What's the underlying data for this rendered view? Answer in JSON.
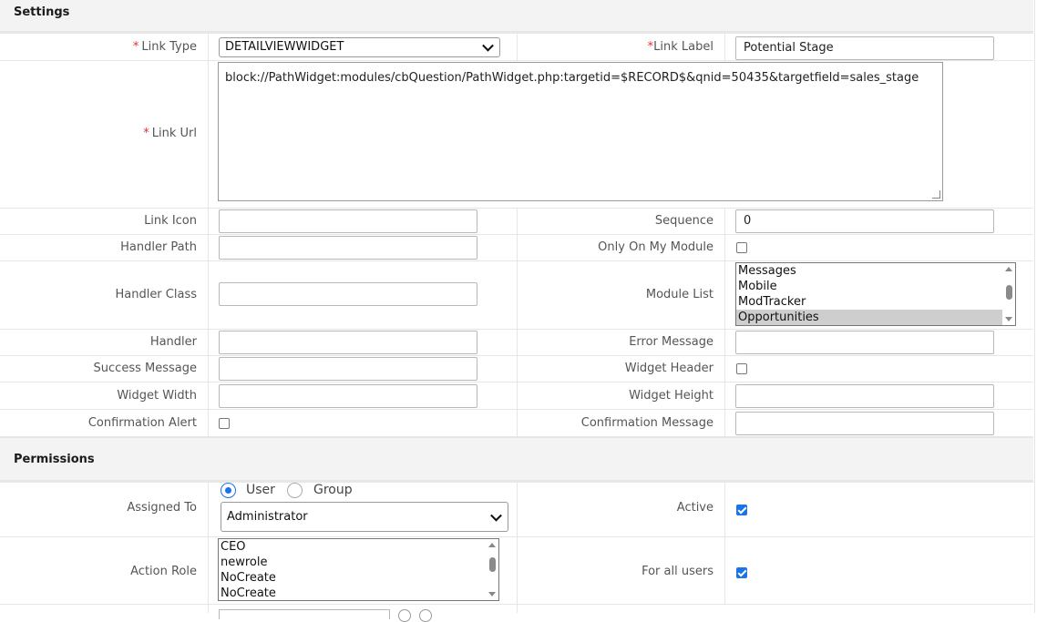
{
  "sections": {
    "settings": "Settings",
    "permissions": "Permissions"
  },
  "fields": {
    "link_type": {
      "label": "Link Type",
      "value": "DETAILVIEWWIDGET"
    },
    "link_label": {
      "label": "Link Label",
      "value": "Potential Stage"
    },
    "link_url": {
      "label": "Link Url",
      "value": "block://PathWidget:modules/cbQuestion/PathWidget.php:targetid=$RECORD$&qnid=50435&targetfield=sales_stage"
    },
    "link_icon": {
      "label": "Link Icon",
      "value": ""
    },
    "sequence": {
      "label": "Sequence",
      "value": "0"
    },
    "handler_path": {
      "label": "Handler Path",
      "value": ""
    },
    "only_on_my_module": {
      "label": "Only On My Module",
      "checked": false
    },
    "handler_class": {
      "label": "Handler Class",
      "value": ""
    },
    "module_list": {
      "label": "Module List",
      "options": [
        "Messages",
        "Mobile",
        "ModTracker",
        "Opportunities"
      ],
      "selected": "Opportunities"
    },
    "handler": {
      "label": "Handler",
      "value": ""
    },
    "error_message": {
      "label": "Error Message",
      "value": ""
    },
    "success_message": {
      "label": "Success Message",
      "value": ""
    },
    "widget_header": {
      "label": "Widget Header",
      "checked": false
    },
    "widget_width": {
      "label": "Widget Width",
      "value": ""
    },
    "widget_height": {
      "label": "Widget Height",
      "value": ""
    },
    "confirmation_alert": {
      "label": "Confirmation Alert",
      "checked": false
    },
    "confirmation_message": {
      "label": "Confirmation Message",
      "value": ""
    }
  },
  "permissions": {
    "assigned_to": {
      "label": "Assigned To",
      "radio_user": "User",
      "radio_group": "Group",
      "selected_radio": "User",
      "value": "Administrator"
    },
    "active": {
      "label": "Active",
      "checked": true
    },
    "action_role": {
      "label": "Action Role",
      "options": [
        "CEO",
        "newrole",
        "NoCreate",
        "NoCreate"
      ]
    },
    "for_all_users": {
      "label": "For all users",
      "checked": true
    }
  },
  "required_marker": "*",
  "colors": {
    "accent": "#1a73e8",
    "required": "#e03131",
    "section_bg": "#f3f3f3"
  }
}
